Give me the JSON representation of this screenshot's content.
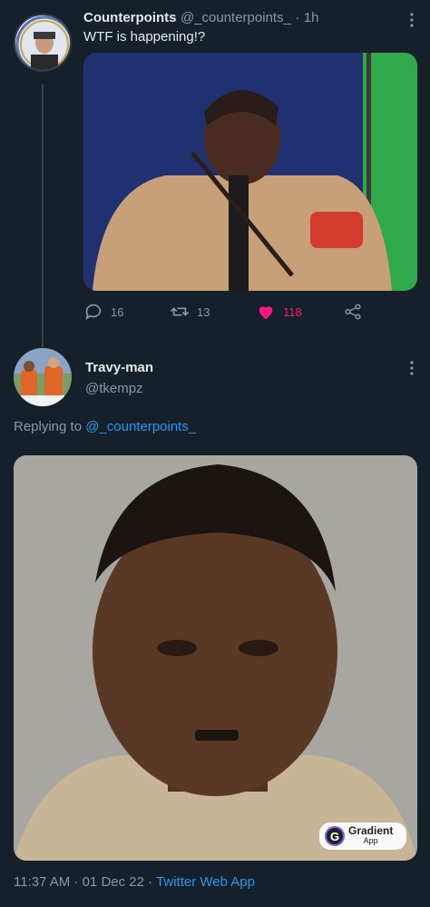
{
  "tweet1": {
    "display_name": "Counterpoints",
    "handle": "@_counterpoints_",
    "separator": "·",
    "time": "1h",
    "text": "WTF is happening!?",
    "media_icon": "photo-people-icon",
    "actions": {
      "reply_count": "16",
      "retweet_count": "13",
      "like_count": "118"
    },
    "colors": {
      "like": "#f91880",
      "muted": "#8b98a5"
    }
  },
  "tweet2": {
    "display_name": "Travy-man",
    "handle": "@tkempz",
    "replying_prefix": "Replying to",
    "replying_handle": "@_counterpoints_",
    "badge_title": "Gradient",
    "badge_sub": "App",
    "badge_logo": "G",
    "timestamp": "11:37 AM · 01 Dec 22 · ",
    "app": "Twitter Web App"
  },
  "theme": {
    "background": "#15202b",
    "accent": "#1d9bf0"
  }
}
